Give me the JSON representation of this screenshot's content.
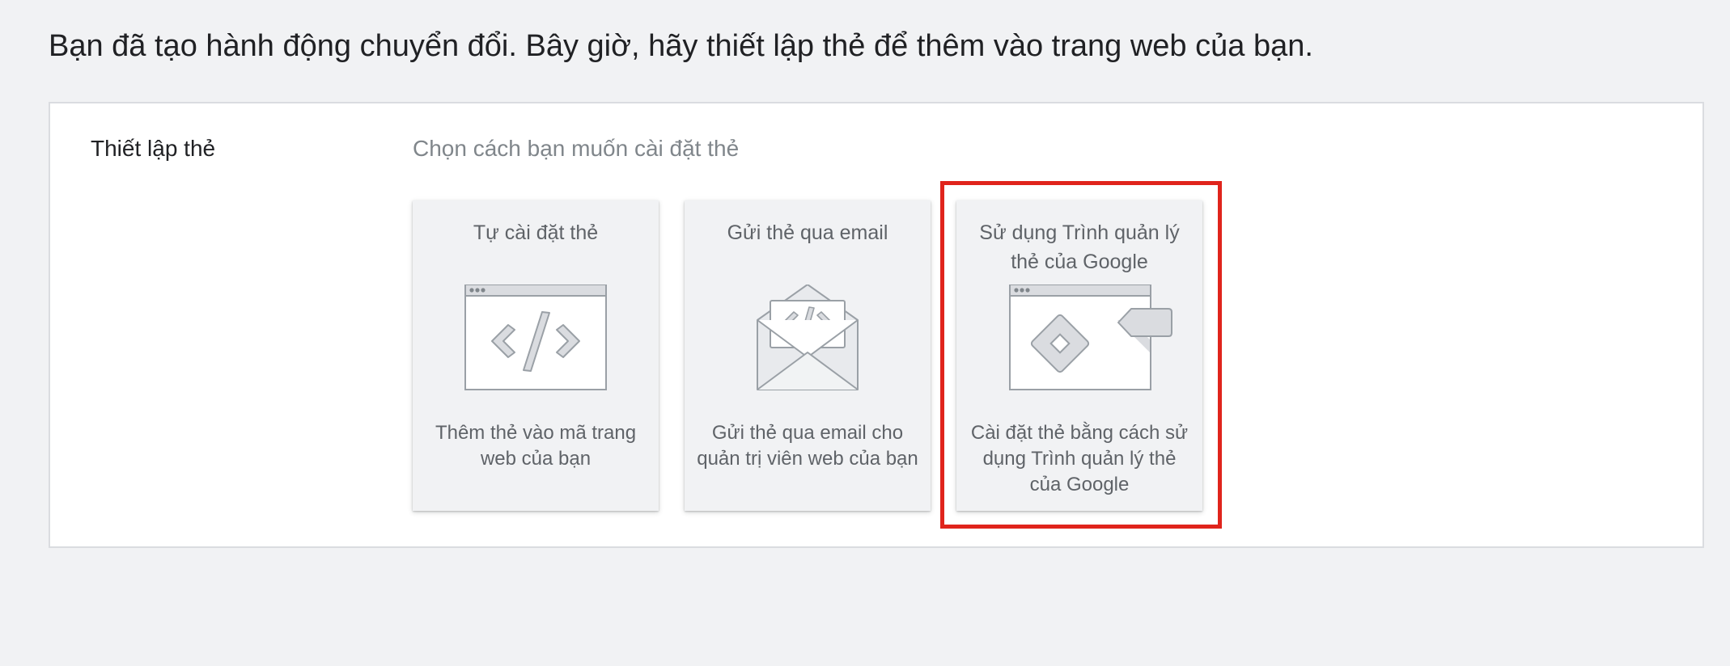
{
  "heading": "Bạn đã tạo hành động chuyển đổi. Bây giờ, hãy thiết lập thẻ để thêm vào trang web của bạn.",
  "setup": {
    "label": "Thiết lập thẻ",
    "prompt": "Chọn cách bạn muốn cài đặt thẻ",
    "options": [
      {
        "title": "Tự cài đặt thẻ",
        "description": "Thêm thẻ vào mã trang web của bạn",
        "icon": "browser-code-icon"
      },
      {
        "title": "Gửi thẻ qua email",
        "description": "Gửi thẻ qua email cho quản trị viên web của bạn",
        "icon": "email-code-icon"
      },
      {
        "title": "Sử dụng Trình quản lý thẻ của Google",
        "description": "Cài đặt thẻ bằng cách sử dụng Trình quản lý thẻ của Google",
        "icon": "google-tag-manager-icon",
        "highlighted": true
      }
    ]
  },
  "colors": {
    "highlight_border": "#e0241c",
    "card_background": "#f1f2f4",
    "panel_background": "#ffffff"
  }
}
